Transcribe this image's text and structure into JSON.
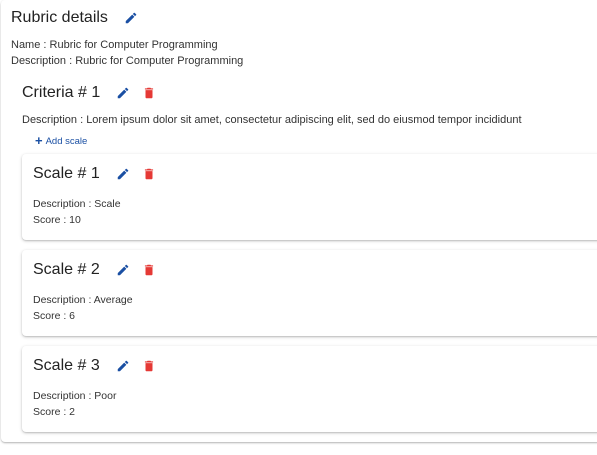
{
  "rubric": {
    "title": "Rubric details",
    "name_line": "Name : Rubric for Computer Programming",
    "description_line": "Description : Rubric for Computer Programming"
  },
  "criteria": {
    "title": "Criteria # 1",
    "description_line": "Description : Lorem ipsum dolor sit amet, consectetur adipiscing elit, sed do eiusmod tempor incididunt",
    "add_scale_label": "Add scale",
    "scales": [
      {
        "title": "Scale # 1",
        "description_line": "Description : Scale",
        "score_line": "Score : 10"
      },
      {
        "title": "Scale # 2",
        "description_line": "Description : Average",
        "score_line": "Score : 6"
      },
      {
        "title": "Scale # 3",
        "description_line": "Description : Poor",
        "score_line": "Score : 2"
      }
    ]
  },
  "icons": {
    "edit": "pencil-icon",
    "delete": "trash-icon",
    "add": "plus-icon"
  },
  "colors": {
    "edit_icon": "#1a4fa3",
    "delete_icon": "#e53935",
    "link": "#1a4fa3"
  }
}
